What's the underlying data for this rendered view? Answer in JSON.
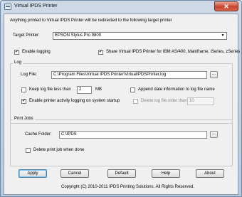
{
  "window": {
    "title": "Virtual IPDS Printer",
    "close_glyph": "✕"
  },
  "intro_text": "Anything printed to Virtual IPDS Printer will be redirected to the following target printer",
  "target_printer": {
    "label": "Target Printer:",
    "value": "EPSON Stylus Pro 9800"
  },
  "enable_logging": {
    "label": "Enable logging",
    "checked": true,
    "glyph": "✓"
  },
  "share_printer": {
    "label": "Share Virtual IPDS Printer for IBM AS/400, Mainframe, iSeries, zSeries",
    "checked": true,
    "glyph": "✓"
  },
  "log_group": {
    "title": "Log",
    "log_file_label": "Log File:",
    "log_file_value": "C:\\Program Files\\Virtual IPDS Printer\\VirtualIPDSPrinter.log",
    "browse_label": "...",
    "keep_less_label": "Keep log file less than",
    "keep_less_value": "2",
    "keep_less_unit": "MB",
    "append_date_label": "Append date information to log file name",
    "enable_activity_label": "Enable printer activity logging on system startup",
    "enable_activity_checked": true,
    "enable_activity_glyph": "✓",
    "delete_older_label": "Delete log file older than",
    "delete_older_value": "10"
  },
  "print_jobs_group": {
    "title": "Print Jobs",
    "cache_folder_label": "Cache Folder:",
    "cache_folder_value": "C:\\IPDS",
    "browse_label": "...",
    "delete_job_label": "Delete print job when done"
  },
  "buttons": {
    "apply": "Apply",
    "cancel": "Cancel",
    "default": "Default",
    "help": "Help",
    "about": "About"
  },
  "copyright": "Copyright (C) 2010-2011 IPDS Printing Solutions.  All Rights Reserved.",
  "colors": {
    "frame": "#b9c9dc",
    "close_button": "#c7432b",
    "client_bg": "#f0f0f0"
  }
}
